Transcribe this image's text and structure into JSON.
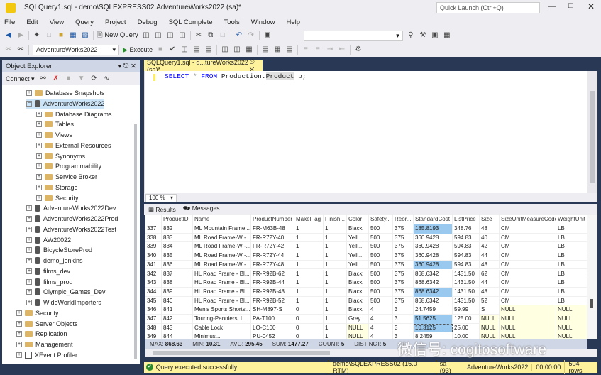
{
  "window": {
    "title": "SQLQuery1.sql - demo\\SQLEXPRESS02.AdventureWorks2022 (sa)*",
    "quick_launch_placeholder": "Quick Launch (Ctrl+Q)"
  },
  "menu": [
    "File",
    "Edit",
    "View",
    "Query",
    "Project",
    "Debug",
    "SQL Complete",
    "Tools",
    "Window",
    "Help"
  ],
  "toolbar": {
    "new_query": "New Query",
    "database": "AdventureWorks2022",
    "execute": "Execute"
  },
  "object_explorer": {
    "title": "Object Explorer",
    "connect": "Connect",
    "items": [
      {
        "label": "Database Snapshots",
        "level": 1,
        "icon": "folder"
      },
      {
        "label": "AdventureWorks2022",
        "level": 1,
        "icon": "database",
        "expanded": true,
        "selected": true
      },
      {
        "label": "Database Diagrams",
        "level": 2,
        "icon": "folder"
      },
      {
        "label": "Tables",
        "level": 2,
        "icon": "folder"
      },
      {
        "label": "Views",
        "level": 2,
        "icon": "folder"
      },
      {
        "label": "External Resources",
        "level": 2,
        "icon": "folder"
      },
      {
        "label": "Synonyms",
        "level": 2,
        "icon": "folder"
      },
      {
        "label": "Programmability",
        "level": 2,
        "icon": "folder"
      },
      {
        "label": "Service Broker",
        "level": 2,
        "icon": "folder"
      },
      {
        "label": "Storage",
        "level": 2,
        "icon": "folder"
      },
      {
        "label": "Security",
        "level": 2,
        "icon": "folder"
      },
      {
        "label": "AdventureWorks2022Dev",
        "level": 1,
        "icon": "database"
      },
      {
        "label": "AdventureWorks2022Prod",
        "level": 1,
        "icon": "database"
      },
      {
        "label": "AdventureWorks2022Test",
        "level": 1,
        "icon": "database"
      },
      {
        "label": "AW20022",
        "level": 1,
        "icon": "database"
      },
      {
        "label": "BicycleStoreProd",
        "level": 1,
        "icon": "database"
      },
      {
        "label": "demo_jenkins",
        "level": 1,
        "icon": "database"
      },
      {
        "label": "films_dev",
        "level": 1,
        "icon": "database"
      },
      {
        "label": "films_prod",
        "level": 1,
        "icon": "database"
      },
      {
        "label": "Olympic_Games_Dev",
        "level": 1,
        "icon": "database"
      },
      {
        "label": "WideWorldImporters",
        "level": 1,
        "icon": "database"
      },
      {
        "label": "Security",
        "level": 0,
        "icon": "folder"
      },
      {
        "label": "Server Objects",
        "level": 0,
        "icon": "folder"
      },
      {
        "label": "Replication",
        "level": 0,
        "icon": "folder"
      },
      {
        "label": "Management",
        "level": 0,
        "icon": "folder"
      },
      {
        "label": "XEvent Profiler",
        "level": 0,
        "icon": "profiler"
      }
    ]
  },
  "editor": {
    "tab": "SQLQuery1.sql - d...tureWorks2022 (sa)*",
    "code": {
      "select": "SELECT",
      "star": "*",
      "from": "FROM",
      "schema": "Production.",
      "table": "Product",
      "alias": " p;"
    },
    "zoom": "100 %"
  },
  "results": {
    "tabs": [
      "Results",
      "Messages"
    ],
    "columns": [
      "",
      "ProductID",
      "Name",
      "ProductNumber",
      "MakeFlag",
      "Finish...",
      "Color",
      "Safety...",
      "Reor...",
      "StandardCost",
      "ListPrice",
      "Size",
      "SizeUnitMeasureCode",
      "WeightUnit"
    ],
    "rows": [
      [
        "337",
        "832",
        "ML Mountain Frame...",
        "FR-M63B-48",
        "1",
        "1",
        "Black",
        "500",
        "375",
        "185.8193",
        "348.76",
        "48",
        "CM",
        "LB"
      ],
      [
        "338",
        "833",
        "ML Road Frame-W -...",
        "FR-R72Y-40",
        "1",
        "1",
        "Yell...",
        "500",
        "375",
        "360.9428",
        "594.83",
        "40",
        "CM",
        "LB"
      ],
      [
        "339",
        "834",
        "ML Road Frame-W -...",
        "FR-R72Y-42",
        "1",
        "1",
        "Yell...",
        "500",
        "375",
        "360.9428",
        "594.83",
        "42",
        "CM",
        "LB"
      ],
      [
        "340",
        "835",
        "ML Road Frame-W -...",
        "FR-R72Y-44",
        "1",
        "1",
        "Yell...",
        "500",
        "375",
        "360.9428",
        "594.83",
        "44",
        "CM",
        "LB"
      ],
      [
        "341",
        "836",
        "ML Road Frame-W -...",
        "FR-R72Y-48",
        "1",
        "1",
        "Yell...",
        "500",
        "375",
        "360.9428",
        "594.83",
        "48",
        "CM",
        "LB"
      ],
      [
        "342",
        "837",
        "HL Road Frame - Bl...",
        "FR-R92B-62",
        "1",
        "1",
        "Black",
        "500",
        "375",
        "868.6342",
        "1431.50",
        "62",
        "CM",
        "LB"
      ],
      [
        "343",
        "838",
        "HL Road Frame - Bl...",
        "FR-R92B-44",
        "1",
        "1",
        "Black",
        "500",
        "375",
        "868.6342",
        "1431.50",
        "44",
        "CM",
        "LB"
      ],
      [
        "344",
        "839",
        "HL Road Frame - Bl...",
        "FR-R92B-48",
        "1",
        "1",
        "Black",
        "500",
        "375",
        "868.6342",
        "1431.50",
        "48",
        "CM",
        "LB"
      ],
      [
        "345",
        "840",
        "HL Road Frame - Bl...",
        "FR-R92B-52",
        "1",
        "1",
        "Black",
        "500",
        "375",
        "868.6342",
        "1431.50",
        "52",
        "CM",
        "LB"
      ],
      [
        "346",
        "841",
        "Men's Sports Shorts...",
        "SH-M897-S",
        "0",
        "1",
        "Black",
        "4",
        "3",
        "24.7459",
        "59.99",
        "S",
        "NULL",
        "NULL"
      ],
      [
        "347",
        "842",
        "Touring-Panniers, L...",
        "PA-T100",
        "0",
        "1",
        "Grey",
        "4",
        "3",
        "51.5625",
        "125.00",
        "NULL",
        "NULL",
        "NULL"
      ],
      [
        "348",
        "843",
        "Cable Lock",
        "LO-C100",
        "0",
        "1",
        "NULL",
        "4",
        "3",
        "10.3125",
        "25.00",
        "NULL",
        "NULL",
        "NULL"
      ],
      [
        "349",
        "844",
        "Minimus...",
        "PU-0452",
        "0",
        "1",
        "NULL",
        "4",
        "3",
        "8.2459",
        "10.00",
        "NULL",
        "NULL",
        "NULL"
      ]
    ],
    "selected_cells": [
      [
        0,
        9
      ],
      [
        4,
        9
      ],
      [
        7,
        9
      ],
      [
        10,
        9
      ],
      [
        11,
        9
      ]
    ],
    "focused_cell": [
      11,
      9
    ],
    "aggregates": [
      {
        "k": "MAX:",
        "v": "868.63"
      },
      {
        "k": "MIN:",
        "v": "10.31"
      },
      {
        "k": "AVG:",
        "v": "295.45"
      },
      {
        "k": "SUM:",
        "v": "1477.27"
      },
      {
        "k": "COUNT:",
        "v": "5"
      },
      {
        "k": "DISTINCT:",
        "v": "5"
      }
    ]
  },
  "status": {
    "message": "Query executed successfully.",
    "server": "demo\\SQLEXPRESS02 (16.0 RTM)",
    "user": "sa (93)",
    "database": "AdventureWorks2022",
    "time": "00:00:00",
    "rows": "504 rows"
  },
  "watermark": "微信号: cogitosoftware",
  "colors": {
    "accent_yellow": "#fff29d",
    "frame": "#293955",
    "selection": "#99c9ef",
    "null_bg": "#ffffe1"
  }
}
